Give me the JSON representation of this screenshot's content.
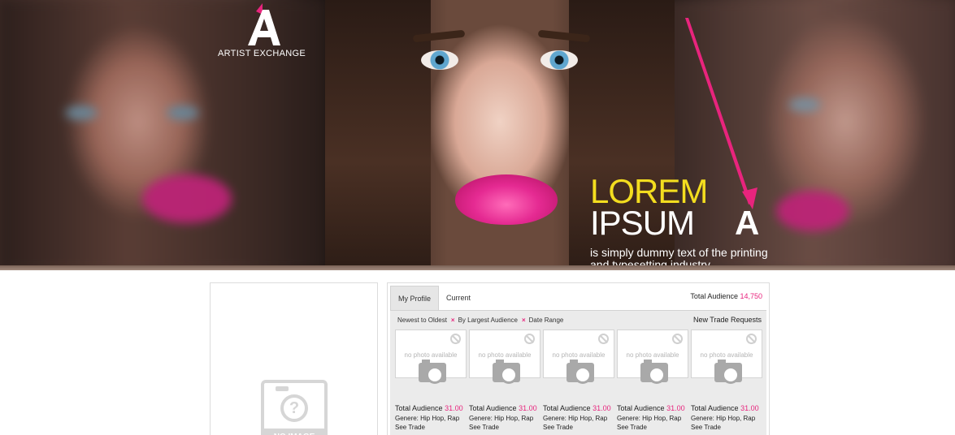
{
  "brand": {
    "logo_text": "ARTIST EXCHANGE",
    "accent_pink": "#e8247d",
    "accent_yellow": "#f3dd1f"
  },
  "hero": {
    "headline_1": "LOREM",
    "headline_2": "IPSUM",
    "headline_mark": "A",
    "description": "is simply dummy text of the printing and typesetting industry."
  },
  "left_panel": {
    "placeholder_icon": "no-image-icon",
    "placeholder_caption": "NO IMAGE"
  },
  "profile_panel": {
    "tabs": [
      {
        "label": "My Profile",
        "active": true
      },
      {
        "label": "Current Review",
        "active": false
      }
    ],
    "total_audience_label": "Total Audience",
    "total_audience_value": "14,750",
    "filters": [
      "Newest to Oldest",
      "By Largest Audience",
      "Date Range"
    ],
    "filter_remove_icon": "×",
    "new_trade_label": "New Trade Requests",
    "cards": [
      {
        "photo_text": "no photo available",
        "audience_label": "Total Audience",
        "audience_value": "31.00",
        "genre": "Genere: Hip Hop, Rap",
        "action": "See Trade"
      },
      {
        "photo_text": "no photo available",
        "audience_label": "Total Audience",
        "audience_value": "31.00",
        "genre": "Genere: Hip Hop, Rap",
        "action": "See Trade"
      },
      {
        "photo_text": "no photo available",
        "audience_label": "Total Audience",
        "audience_value": "31.00",
        "genre": "Genere: Hip Hop, Rap",
        "action": "See Trade"
      },
      {
        "photo_text": "no photo available",
        "audience_label": "Total Audience",
        "audience_value": "31.00",
        "genre": "Genere: Hip Hop, Rap",
        "action": "See Trade"
      },
      {
        "photo_text": "no photo available",
        "audience_label": "Total Audience",
        "audience_value": "31.00",
        "genre": "Genere: Hip Hop, Rap",
        "action": "See Trade"
      }
    ]
  }
}
